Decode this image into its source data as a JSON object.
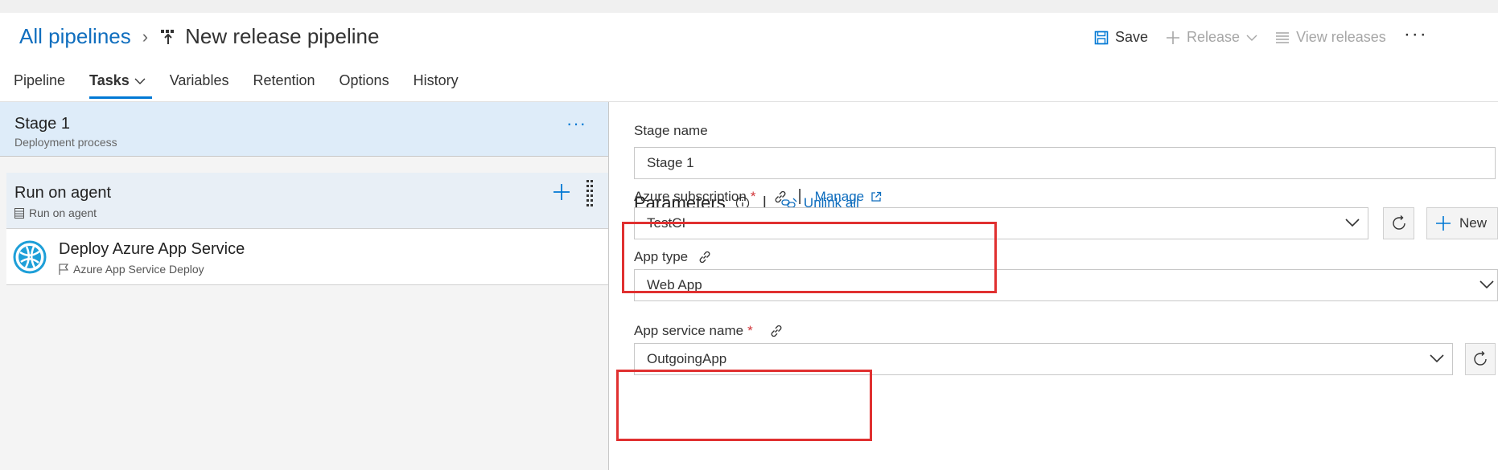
{
  "breadcrumb": {
    "root": "All pipelines",
    "title": "New release pipeline"
  },
  "toolbar": {
    "save": "Save",
    "release": "Release",
    "view_releases": "View releases",
    "more": "···"
  },
  "tabs": [
    {
      "label": "Pipeline"
    },
    {
      "label": "Tasks"
    },
    {
      "label": "Variables"
    },
    {
      "label": "Retention"
    },
    {
      "label": "Options"
    },
    {
      "label": "History"
    }
  ],
  "left": {
    "stage": {
      "title": "Stage 1",
      "subtitle": "Deployment process",
      "more": "···"
    },
    "agent": {
      "title": "Run on agent",
      "subtitle": "Run on agent"
    },
    "task": {
      "title": "Deploy Azure App Service",
      "subtitle": "Azure App Service Deploy"
    }
  },
  "form": {
    "stage_name_label": "Stage name",
    "stage_name_value": "Stage 1",
    "parameters_title": "Parameters",
    "unlink_all": "Unlink all",
    "subscription_label": "Azure subscription",
    "manage": "Manage",
    "subscription_value": "TestCI",
    "new_button": "New",
    "app_type_label": "App type",
    "app_type_value": "Web App",
    "app_service_label": "App service name",
    "app_service_value": "OutgoingApp",
    "required_mark": "*"
  },
  "colors": {
    "accent": "#0078d4",
    "link": "#106ebe",
    "highlight": "#e03030",
    "stage_bg": "#deecf9"
  }
}
